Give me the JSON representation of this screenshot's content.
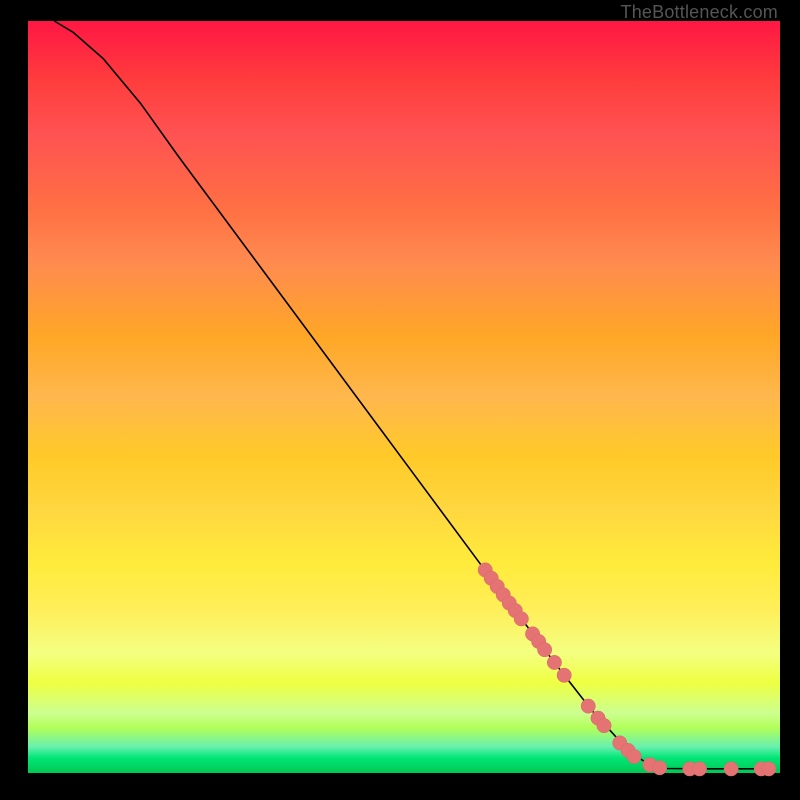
{
  "watermark": "TheBottleneck.com",
  "chart_data": {
    "type": "line",
    "title": "",
    "xlabel": "",
    "ylabel": "",
    "xlim": [
      0,
      100
    ],
    "ylim": [
      0,
      100
    ],
    "note": "Axes unlabeled; values are normalized percentages across the 752×752 plot area. Curve descends from top-left to bottom-right across a vertical red→green gradient.",
    "curve_points": [
      {
        "x": 3.5,
        "y": 100.0
      },
      {
        "x": 6.0,
        "y": 98.5
      },
      {
        "x": 10.0,
        "y": 95.0
      },
      {
        "x": 15.0,
        "y": 89.0
      },
      {
        "x": 20.0,
        "y": 82.0
      },
      {
        "x": 30.0,
        "y": 68.5
      },
      {
        "x": 40.0,
        "y": 55.0
      },
      {
        "x": 50.0,
        "y": 41.5
      },
      {
        "x": 60.0,
        "y": 28.0
      },
      {
        "x": 66.0,
        "y": 20.0
      },
      {
        "x": 70.0,
        "y": 14.7
      },
      {
        "x": 75.0,
        "y": 8.3
      },
      {
        "x": 80.0,
        "y": 2.8
      },
      {
        "x": 82.5,
        "y": 1.2
      },
      {
        "x": 85.0,
        "y": 0.6
      },
      {
        "x": 90.0,
        "y": 0.55
      },
      {
        "x": 95.0,
        "y": 0.55
      },
      {
        "x": 98.0,
        "y": 0.55
      }
    ],
    "markers": [
      {
        "x": 60.8,
        "y": 27.0
      },
      {
        "x": 61.6,
        "y": 25.9
      },
      {
        "x": 62.4,
        "y": 24.8
      },
      {
        "x": 63.2,
        "y": 23.7
      },
      {
        "x": 64.0,
        "y": 22.6
      },
      {
        "x": 64.8,
        "y": 21.6
      },
      {
        "x": 65.6,
        "y": 20.5
      },
      {
        "x": 67.1,
        "y": 18.5
      },
      {
        "x": 67.9,
        "y": 17.5
      },
      {
        "x": 68.7,
        "y": 16.4
      },
      {
        "x": 70.0,
        "y": 14.7
      },
      {
        "x": 71.3,
        "y": 13.0
      },
      {
        "x": 74.5,
        "y": 8.9
      },
      {
        "x": 75.8,
        "y": 7.3
      },
      {
        "x": 76.6,
        "y": 6.3
      },
      {
        "x": 78.7,
        "y": 4.0
      },
      {
        "x": 79.8,
        "y": 3.0
      },
      {
        "x": 80.6,
        "y": 2.2
      },
      {
        "x": 82.7,
        "y": 1.1
      },
      {
        "x": 84.0,
        "y": 0.7
      },
      {
        "x": 88.0,
        "y": 0.55
      },
      {
        "x": 89.3,
        "y": 0.55
      },
      {
        "x": 93.5,
        "y": 0.55
      },
      {
        "x": 97.5,
        "y": 0.55
      },
      {
        "x": 98.5,
        "y": 0.55
      }
    ],
    "colors": {
      "curve": "#000000",
      "marker_fill": "#e57373",
      "marker_stroke": "#d46a6a"
    }
  }
}
